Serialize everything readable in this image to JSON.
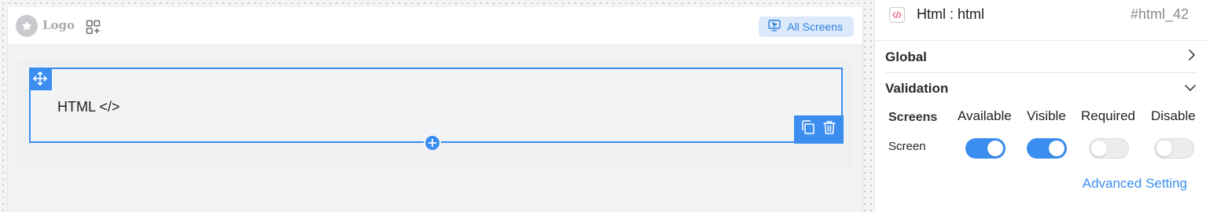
{
  "canvas": {
    "header": {
      "logo_text": "Logo",
      "all_screens_label": "All Screens"
    },
    "html_block": {
      "label": "HTML",
      "code_glyph": "</>"
    }
  },
  "panel": {
    "component_title": "Html : html",
    "component_id": "#html_42",
    "sections": {
      "global_label": "Global",
      "validation_label": "Validation"
    },
    "validation": {
      "columns": {
        "screens": "Screens",
        "available": "Available",
        "visible": "Visible",
        "required": "Required",
        "disable": "Disable"
      },
      "rows": [
        {
          "name": "Screen",
          "available": true,
          "visible": true,
          "required": false,
          "disable": false
        }
      ]
    },
    "advanced_setting_label": "Advanced Setting"
  },
  "colors": {
    "accent": "#3b8ef0",
    "accent_light": "#dbe9fb",
    "toggle_off": "#ececee"
  },
  "icons": [
    "star-icon",
    "widgets-icon",
    "screen-cursor-icon",
    "move-icon",
    "copy-icon",
    "trash-icon",
    "plus-icon",
    "code-icon",
    "chevron-right-icon",
    "chevron-down-icon"
  ]
}
